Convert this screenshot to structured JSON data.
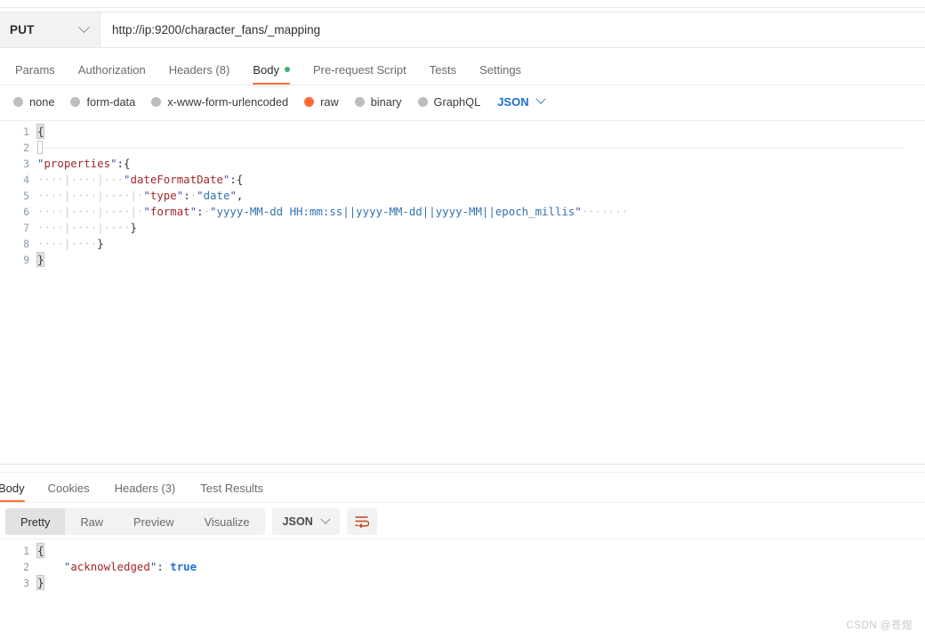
{
  "request": {
    "method": "PUT",
    "url": "http://ip:9200/character_fans/_mapping",
    "tabs": [
      {
        "label": "Params",
        "active": false,
        "dot": false
      },
      {
        "label": "Authorization",
        "active": false,
        "dot": false
      },
      {
        "label": "Headers (8)",
        "active": false,
        "dot": false
      },
      {
        "label": "Body",
        "active": true,
        "dot": true
      },
      {
        "label": "Pre-request Script",
        "active": false,
        "dot": false
      },
      {
        "label": "Tests",
        "active": false,
        "dot": false
      },
      {
        "label": "Settings",
        "active": false,
        "dot": false
      }
    ],
    "body_types": [
      {
        "label": "none",
        "selected": false
      },
      {
        "label": "form-data",
        "selected": false
      },
      {
        "label": "x-www-form-urlencoded",
        "selected": false
      },
      {
        "label": "raw",
        "selected": true
      },
      {
        "label": "binary",
        "selected": false
      },
      {
        "label": "GraphQL",
        "selected": false
      }
    ],
    "format_selected": "JSON",
    "editor_lines": [
      {
        "n": "1",
        "text": "{"
      },
      {
        "n": "2",
        "text": ""
      },
      {
        "n": "3",
        "text": "\"properties\":{"
      },
      {
        "n": "4",
        "text": "            \"dateFormatDate\":{"
      },
      {
        "n": "5",
        "text": "                \"type\": \"date\","
      },
      {
        "n": "6",
        "text": "                \"format\": \"yyyy-MM-dd HH:mm:ss||yyyy-MM-dd||yyyy-MM||epoch_millis\""
      },
      {
        "n": "7",
        "text": "            }"
      },
      {
        "n": "8",
        "text": "        }"
      },
      {
        "n": "9",
        "text": "}"
      }
    ],
    "tokens": {
      "properties_key": "properties",
      "date_format_date_key": "dateFormatDate",
      "type_key": "type",
      "type_value": "date",
      "format_key": "format",
      "format_value": "yyyy-MM-dd HH:mm:ss||yyyy-MM-dd||yyyy-MM||epoch_millis"
    }
  },
  "response": {
    "tabs": [
      {
        "label": "Body",
        "active": true
      },
      {
        "label": "Cookies",
        "active": false
      },
      {
        "label": "Headers (3)",
        "active": false
      },
      {
        "label": "Test Results",
        "active": false
      }
    ],
    "views": [
      {
        "label": "Pretty",
        "active": true
      },
      {
        "label": "Raw",
        "active": false
      },
      {
        "label": "Preview",
        "active": false
      },
      {
        "label": "Visualize",
        "active": false
      }
    ],
    "format_selected": "JSON",
    "lines": [
      {
        "n": "1"
      },
      {
        "n": "2"
      },
      {
        "n": "3"
      }
    ],
    "acknowledged_key": "acknowledged",
    "acknowledged_value": "true"
  },
  "watermark": "CSDN @苍煜",
  "colors": {
    "accent": "#ff6c37",
    "link": "#1d6fd4",
    "json_key": "#a3272b",
    "json_string": "#3572b0",
    "status_dot": "#3bb273"
  }
}
